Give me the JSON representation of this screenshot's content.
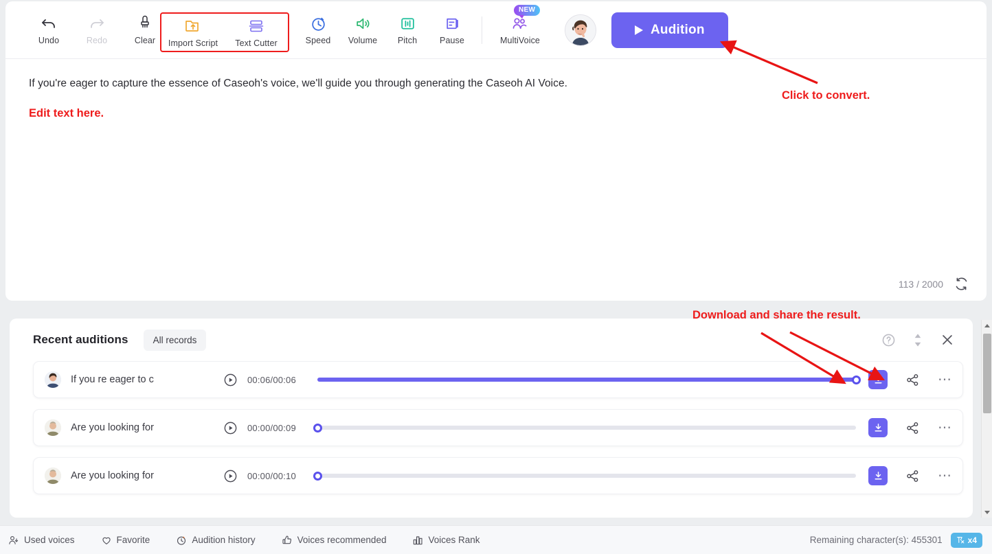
{
  "toolbar": {
    "items": [
      {
        "label": "Undo",
        "icon": "undo-icon",
        "disabled": false
      },
      {
        "label": "Redo",
        "icon": "redo-icon",
        "disabled": true
      },
      {
        "label": "Clear",
        "icon": "clear-brush-icon",
        "disabled": false
      }
    ],
    "boxed_group": [
      {
        "label": "Import Script",
        "icon": "import-folder-icon"
      },
      {
        "label": "Text Cutter",
        "icon": "text-cutter-icon"
      }
    ],
    "effects": [
      {
        "label": "Speed",
        "icon": "speed-stopwatch-icon",
        "color": "#3b6fe0"
      },
      {
        "label": "Volume",
        "icon": "volume-speaker-icon",
        "color": "#2eb872"
      },
      {
        "label": "Pitch",
        "icon": "pitch-equalizer-icon",
        "color": "#1fbf9c"
      },
      {
        "label": "Pause",
        "icon": "pause-insert-icon",
        "color": "#6c63f0"
      }
    ],
    "multivoice": {
      "label": "MultiVoice",
      "icon": "multivoice-people-icon",
      "badge": "NEW"
    },
    "avatar": {
      "name": "user-avatar"
    },
    "audition_button": {
      "label": "Audition",
      "icon": "play-icon",
      "color": "#6c63f0"
    }
  },
  "editor": {
    "text": "If you're eager to capture the essence of Caseoh's voice, we'll guide you through generating the Caseoh AI Voice.",
    "note": "Edit text here.",
    "char_count": "113",
    "char_sep": "/",
    "char_limit": "2000",
    "refresh_icon": "refresh-icon"
  },
  "annotations": {
    "convert": "Click to convert.",
    "download": "Download and share the result.",
    "color": "#ee1c1c"
  },
  "panel": {
    "title": "Recent auditions",
    "all_records": "All records",
    "actions": [
      {
        "name": "help-icon",
        "label": "?"
      },
      {
        "name": "sort-updown-icon",
        "label": ""
      },
      {
        "name": "close-icon",
        "label": "×"
      }
    ],
    "rows": [
      {
        "title": "If you re eager to c",
        "time": "00:06/00:06",
        "progress": 100,
        "play_icon": "play-circle-icon",
        "download_icon": "download-icon",
        "share_icon": "share-icon",
        "more_icon": "more-options-icon"
      },
      {
        "title": "Are you looking for",
        "time": "00:00/00:09",
        "progress": 0,
        "play_icon": "play-circle-icon",
        "download_icon": "download-icon",
        "share_icon": "share-icon",
        "more_icon": "more-options-icon"
      },
      {
        "title": "Are you looking for",
        "time": "00:00/00:10",
        "progress": 0,
        "play_icon": "play-circle-icon",
        "download_icon": "download-icon",
        "share_icon": "share-icon",
        "more_icon": "more-options-icon"
      }
    ]
  },
  "bottom_bar": {
    "items": [
      {
        "label": "Used voices",
        "icon": "used-voices-icon"
      },
      {
        "label": "Favorite",
        "icon": "heart-icon"
      },
      {
        "label": "Audition history",
        "icon": "history-clock-icon"
      },
      {
        "label": "Voices recommended",
        "icon": "thumbs-up-icon"
      },
      {
        "label": "Voices Rank",
        "icon": "rank-bars-icon"
      }
    ],
    "remaining_label": "Remaining character(s): 455301",
    "multiplier_badge": "x4",
    "badge_color": "#56b6e8"
  }
}
